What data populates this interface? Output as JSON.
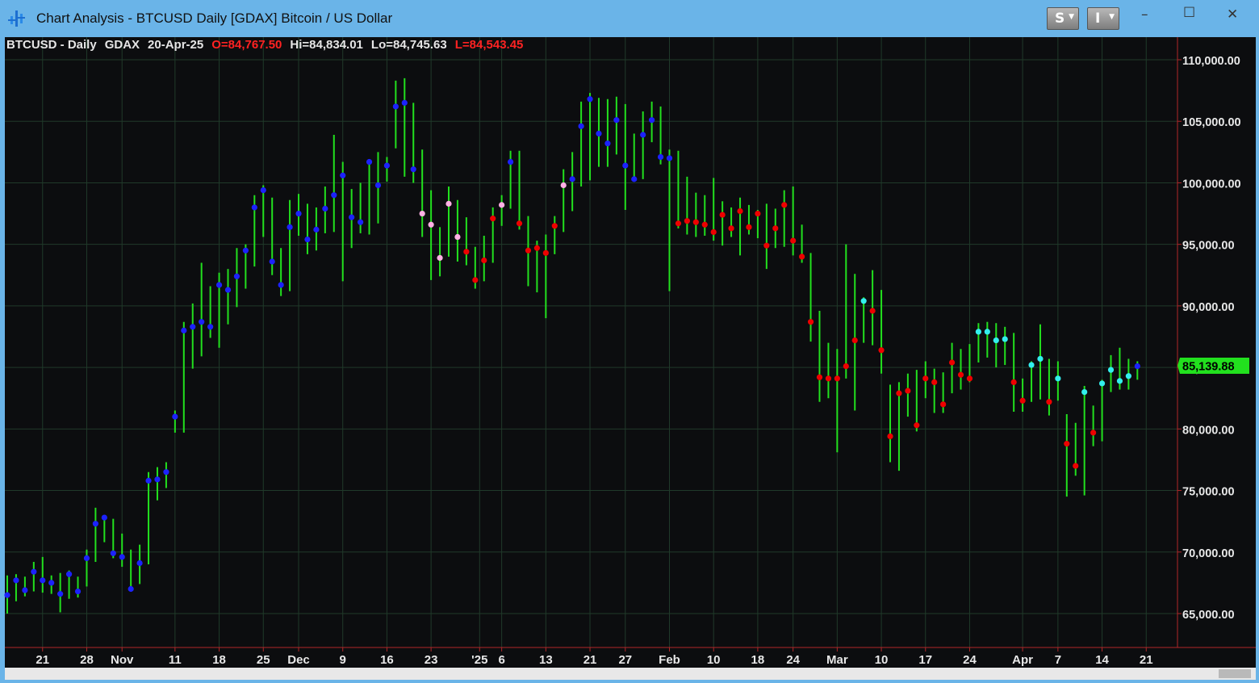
{
  "window": {
    "title": "Chart Analysis - BTCUSD Daily [GDAX] Bitcoin / US Dollar",
    "btn_s": "S",
    "btn_i": "I",
    "minimize_icon": "minimize-icon",
    "maximize_icon": "maximize-icon",
    "close_icon": "close-icon"
  },
  "header": {
    "symbol": "BTCUSD - Daily",
    "exchange": "GDAX",
    "date": "20-Apr-25",
    "open": "O=84,767.50",
    "high": "Hi=84,834.01",
    "low": "Lo=84,745.63",
    "last": "L=84,543.45"
  },
  "colors": {
    "bar": "#22e01e",
    "grid": "#203a2a",
    "axis_line": "#b0282a",
    "background": "#0c0d0f",
    "dot_blue": "#1c22ff",
    "dot_red": "#ee0000",
    "dot_pink": "#ffb0e4",
    "dot_cyan": "#33eeee",
    "last_price_bg": "#22e01e"
  },
  "chart_data": {
    "type": "ohlc-range-bars",
    "ylim": [
      62000,
      111000
    ],
    "y_ticks": [
      {
        "value": 65000,
        "label": "65,000.00"
      },
      {
        "value": 70000,
        "label": "70,000.00"
      },
      {
        "value": 75000,
        "label": "75,000.00"
      },
      {
        "value": 80000,
        "label": "80,000.00"
      },
      {
        "value": 85000,
        "label": "85,000.00"
      },
      {
        "value": 90000,
        "label": "90,000.00"
      },
      {
        "value": 95000,
        "label": "95,000.00"
      },
      {
        "value": 100000,
        "label": "100,000.00"
      },
      {
        "value": 105000,
        "label": "105,000.00"
      },
      {
        "value": 110000,
        "label": "110,000.00"
      }
    ],
    "x_ticks": [
      {
        "day": 4,
        "label": "21"
      },
      {
        "day": 9,
        "label": "28"
      },
      {
        "day": 13,
        "label": "Nov"
      },
      {
        "day": 19,
        "label": "11"
      },
      {
        "day": 24,
        "label": "18"
      },
      {
        "day": 29,
        "label": "25"
      },
      {
        "day": 33,
        "label": "Dec"
      },
      {
        "day": 38,
        "label": "9"
      },
      {
        "day": 43,
        "label": "16"
      },
      {
        "day": 48,
        "label": "23"
      },
      {
        "day": 53.5,
        "label": "'25"
      },
      {
        "day": 56,
        "label": "6"
      },
      {
        "day": 61,
        "label": "13"
      },
      {
        "day": 66,
        "label": "21"
      },
      {
        "day": 70,
        "label": "27"
      },
      {
        "day": 75,
        "label": "Feb"
      },
      {
        "day": 80,
        "label": "10"
      },
      {
        "day": 85,
        "label": "18"
      },
      {
        "day": 89,
        "label": "24"
      },
      {
        "day": 94,
        "label": "Mar"
      },
      {
        "day": 99,
        "label": "10"
      },
      {
        "day": 104,
        "label": "17"
      },
      {
        "day": 109,
        "label": "24"
      },
      {
        "day": 115,
        "label": "Apr"
      },
      {
        "day": 119,
        "label": "7"
      },
      {
        "day": 124,
        "label": "14"
      },
      {
        "day": 129,
        "label": "21"
      }
    ],
    "last_price": 85139.88,
    "last_price_label": "85,139.88",
    "bars": [
      {
        "h": 68100,
        "l": 65000,
        "c": 66500,
        "m": "blue"
      },
      {
        "h": 68200,
        "l": 66000,
        "c": 67700,
        "m": "blue"
      },
      {
        "h": 68000,
        "l": 66400,
        "c": 66900,
        "m": "blue"
      },
      {
        "h": 69200,
        "l": 66800,
        "c": 68400,
        "m": "blue"
      },
      {
        "h": 69600,
        "l": 66700,
        "c": 67700,
        "m": "blue"
      },
      {
        "h": 68100,
        "l": 66600,
        "c": 67500,
        "m": "blue"
      },
      {
        "h": 68300,
        "l": 65100,
        "c": 66600,
        "m": "blue"
      },
      {
        "h": 68500,
        "l": 66200,
        "c": 68200,
        "m": "blue"
      },
      {
        "h": 68000,
        "l": 66300,
        "c": 66800,
        "m": "blue"
      },
      {
        "h": 70200,
        "l": 67200,
        "c": 69500,
        "m": "blue"
      },
      {
        "h": 73600,
        "l": 69200,
        "c": 72300,
        "m": "blue"
      },
      {
        "h": 73000,
        "l": 70800,
        "c": 72800,
        "m": "blue"
      },
      {
        "h": 72700,
        "l": 69500,
        "c": 69900,
        "m": "blue"
      },
      {
        "h": 71500,
        "l": 68800,
        "c": 69600,
        "m": "blue"
      },
      {
        "h": 70200,
        "l": 66800,
        "c": 67000,
        "m": "blue"
      },
      {
        "h": 70600,
        "l": 67400,
        "c": 69100,
        "m": "blue"
      },
      {
        "h": 76500,
        "l": 69000,
        "c": 75800,
        "m": "blue"
      },
      {
        "h": 76900,
        "l": 74200,
        "c": 75900,
        "m": "blue"
      },
      {
        "h": 77300,
        "l": 75200,
        "c": 76500,
        "m": "blue"
      },
      {
        "h": 81500,
        "l": 79700,
        "c": 81000,
        "m": "blue"
      },
      {
        "h": 88700,
        "l": 79700,
        "c": 88000,
        "m": "blue"
      },
      {
        "h": 90200,
        "l": 84900,
        "c": 88300,
        "m": "blue"
      },
      {
        "h": 93500,
        "l": 85900,
        "c": 88700,
        "m": "blue"
      },
      {
        "h": 91600,
        "l": 87400,
        "c": 88300,
        "m": "blue"
      },
      {
        "h": 92700,
        "l": 86600,
        "c": 91700,
        "m": "blue"
      },
      {
        "h": 93000,
        "l": 88500,
        "c": 91300,
        "m": "blue"
      },
      {
        "h": 94700,
        "l": 89900,
        "c": 92400,
        "m": "blue"
      },
      {
        "h": 95000,
        "l": 91400,
        "c": 94500,
        "m": "blue"
      },
      {
        "h": 99000,
        "l": 93200,
        "c": 98000,
        "m": "blue"
      },
      {
        "h": 99800,
        "l": 95600,
        "c": 99400,
        "m": "blue"
      },
      {
        "h": 98800,
        "l": 92500,
        "c": 93600,
        "m": "blue"
      },
      {
        "h": 94700,
        "l": 90800,
        "c": 91700,
        "m": "blue"
      },
      {
        "h": 98600,
        "l": 91200,
        "c": 96400,
        "m": "blue"
      },
      {
        "h": 99100,
        "l": 95700,
        "c": 97500,
        "m": "blue"
      },
      {
        "h": 98300,
        "l": 94200,
        "c": 95400,
        "m": "blue"
      },
      {
        "h": 98000,
        "l": 94500,
        "c": 96200,
        "m": "blue"
      },
      {
        "h": 99700,
        "l": 95900,
        "c": 97900,
        "m": "blue"
      },
      {
        "h": 103900,
        "l": 96000,
        "c": 99000,
        "m": "blue"
      },
      {
        "h": 101700,
        "l": 92000,
        "c": 100600,
        "m": "blue"
      },
      {
        "h": 99500,
        "l": 94700,
        "c": 97200,
        "m": "blue"
      },
      {
        "h": 100000,
        "l": 95900,
        "c": 96800,
        "m": "blue"
      },
      {
        "h": 101900,
        "l": 95800,
        "c": 101700,
        "m": "blue"
      },
      {
        "h": 102500,
        "l": 96700,
        "c": 99800,
        "m": "blue"
      },
      {
        "h": 102100,
        "l": 100100,
        "c": 101400,
        "m": "blue"
      },
      {
        "h": 108300,
        "l": 102800,
        "c": 106200,
        "m": "blue"
      },
      {
        "h": 108500,
        "l": 100500,
        "c": 106500,
        "m": "blue"
      },
      {
        "h": 106500,
        "l": 100000,
        "c": 101100,
        "m": "blue"
      },
      {
        "h": 102700,
        "l": 95600,
        "c": 97500,
        "m": "pink"
      },
      {
        "h": 99400,
        "l": 92100,
        "c": 96600,
        "m": "pink"
      },
      {
        "h": 96400,
        "l": 92400,
        "c": 93900,
        "m": "pink"
      },
      {
        "h": 99700,
        "l": 94000,
        "c": 98300,
        "m": "pink"
      },
      {
        "h": 98600,
        "l": 93600,
        "c": 95600,
        "m": "pink"
      },
      {
        "h": 97200,
        "l": 93300,
        "c": 94400,
        "m": "red"
      },
      {
        "h": 94800,
        "l": 91400,
        "c": 92100,
        "m": "red"
      },
      {
        "h": 95700,
        "l": 92000,
        "c": 93700,
        "m": "red"
      },
      {
        "h": 98000,
        "l": 93500,
        "c": 97100,
        "m": "red"
      },
      {
        "h": 99000,
        "l": 96500,
        "c": 98200,
        "m": "pink"
      },
      {
        "h": 102600,
        "l": 97900,
        "c": 101700,
        "m": "blue"
      },
      {
        "h": 102600,
        "l": 96200,
        "c": 96700,
        "m": "red"
      },
      {
        "h": 97300,
        "l": 91600,
        "c": 94500,
        "m": "red"
      },
      {
        "h": 95300,
        "l": 91100,
        "c": 94700,
        "m": "red"
      },
      {
        "h": 95800,
        "l": 89000,
        "c": 94300,
        "m": "red"
      },
      {
        "h": 97300,
        "l": 94200,
        "c": 96500,
        "m": "red"
      },
      {
        "h": 101100,
        "l": 96000,
        "c": 99800,
        "m": "pink"
      },
      {
        "h": 102500,
        "l": 97700,
        "c": 100300,
        "m": "blue"
      },
      {
        "h": 106600,
        "l": 99700,
        "c": 104600,
        "m": "blue"
      },
      {
        "h": 107300,
        "l": 100200,
        "c": 106800,
        "m": "blue"
      },
      {
        "h": 106900,
        "l": 101300,
        "c": 104000,
        "m": "blue"
      },
      {
        "h": 106800,
        "l": 101300,
        "c": 103200,
        "m": "blue"
      },
      {
        "h": 107000,
        "l": 102300,
        "c": 105100,
        "m": "blue"
      },
      {
        "h": 106400,
        "l": 97800,
        "c": 101400,
        "m": "blue"
      },
      {
        "h": 104000,
        "l": 100400,
        "c": 100300,
        "m": "blue"
      },
      {
        "h": 105800,
        "l": 100300,
        "c": 103900,
        "m": "blue"
      },
      {
        "h": 106600,
        "l": 103300,
        "c": 105100,
        "m": "blue"
      },
      {
        "h": 106200,
        "l": 101500,
        "c": 102100,
        "m": "blue"
      },
      {
        "h": 102700,
        "l": 91200,
        "c": 102000,
        "m": "blue"
      },
      {
        "h": 102600,
        "l": 96300,
        "c": 96700,
        "m": "red"
      },
      {
        "h": 100500,
        "l": 95800,
        "c": 96900,
        "m": "red"
      },
      {
        "h": 99200,
        "l": 95600,
        "c": 96800,
        "m": "red"
      },
      {
        "h": 99000,
        "l": 95700,
        "c": 96600,
        "m": "red"
      },
      {
        "h": 100400,
        "l": 95300,
        "c": 96000,
        "m": "red"
      },
      {
        "h": 98500,
        "l": 94900,
        "c": 97400,
        "m": "red"
      },
      {
        "h": 98000,
        "l": 95600,
        "c": 96300,
        "m": "red"
      },
      {
        "h": 98800,
        "l": 94100,
        "c": 97700,
        "m": "red"
      },
      {
        "h": 98200,
        "l": 95800,
        "c": 96400,
        "m": "red"
      },
      {
        "h": 97800,
        "l": 95500,
        "c": 97500,
        "m": "red"
      },
      {
        "h": 98300,
        "l": 93000,
        "c": 94900,
        "m": "red"
      },
      {
        "h": 97900,
        "l": 94700,
        "c": 96300,
        "m": "red"
      },
      {
        "h": 99400,
        "l": 94800,
        "c": 98200,
        "m": "red"
      },
      {
        "h": 99700,
        "l": 94100,
        "c": 95300,
        "m": "red"
      },
      {
        "h": 96600,
        "l": 93500,
        "c": 94000,
        "m": "red"
      },
      {
        "h": 94300,
        "l": 87100,
        "c": 88700,
        "m": "red"
      },
      {
        "h": 89600,
        "l": 82200,
        "c": 84200,
        "m": "red"
      },
      {
        "h": 87000,
        "l": 82500,
        "c": 84100,
        "m": "red"
      },
      {
        "h": 86500,
        "l": 78100,
        "c": 84100,
        "m": "red"
      },
      {
        "h": 95000,
        "l": 84100,
        "c": 85100,
        "m": "red"
      },
      {
        "h": 92600,
        "l": 81500,
        "c": 87200,
        "m": "red"
      },
      {
        "h": 90700,
        "l": 87000,
        "c": 90400,
        "m": "cyan"
      },
      {
        "h": 92900,
        "l": 86800,
        "c": 89600,
        "m": "red"
      },
      {
        "h": 91300,
        "l": 84500,
        "c": 86400,
        "m": "red"
      },
      {
        "h": 83600,
        "l": 77300,
        "c": 79400,
        "m": "red"
      },
      {
        "h": 83800,
        "l": 76600,
        "c": 82900,
        "m": "red"
      },
      {
        "h": 84500,
        "l": 81000,
        "c": 83100,
        "m": "red"
      },
      {
        "h": 84800,
        "l": 79800,
        "c": 80300,
        "m": "red"
      },
      {
        "h": 85500,
        "l": 82500,
        "c": 84100,
        "m": "red"
      },
      {
        "h": 84900,
        "l": 81300,
        "c": 83800,
        "m": "red"
      },
      {
        "h": 84600,
        "l": 81300,
        "c": 82000,
        "m": "red"
      },
      {
        "h": 87000,
        "l": 82900,
        "c": 85400,
        "m": "red"
      },
      {
        "h": 86500,
        "l": 83200,
        "c": 84400,
        "m": "red"
      },
      {
        "h": 86900,
        "l": 83800,
        "c": 84100,
        "m": "red"
      },
      {
        "h": 88600,
        "l": 85400,
        "c": 87900,
        "m": "cyan"
      },
      {
        "h": 88700,
        "l": 85800,
        "c": 87900,
        "m": "cyan"
      },
      {
        "h": 88600,
        "l": 85000,
        "c": 87200,
        "m": "cyan"
      },
      {
        "h": 88300,
        "l": 85200,
        "c": 87300,
        "m": "cyan"
      },
      {
        "h": 87800,
        "l": 81400,
        "c": 83800,
        "m": "red"
      },
      {
        "h": 84100,
        "l": 81400,
        "c": 82300,
        "m": "red"
      },
      {
        "h": 85500,
        "l": 82200,
        "c": 85200,
        "m": "cyan"
      },
      {
        "h": 88500,
        "l": 82400,
        "c": 85700,
        "m": "cyan"
      },
      {
        "h": 85700,
        "l": 81100,
        "c": 82200,
        "m": "red"
      },
      {
        "h": 85500,
        "l": 82300,
        "c": 84100,
        "m": "cyan"
      },
      {
        "h": 81200,
        "l": 74500,
        "c": 78800,
        "m": "red"
      },
      {
        "h": 80500,
        "l": 76200,
        "c": 77000,
        "m": "red"
      },
      {
        "h": 83500,
        "l": 74600,
        "c": 83000,
        "m": "cyan"
      },
      {
        "h": 81900,
        "l": 78600,
        "c": 79700,
        "m": "red"
      },
      {
        "h": 84000,
        "l": 79000,
        "c": 83700,
        "m": "cyan"
      },
      {
        "h": 86000,
        "l": 83000,
        "c": 84800,
        "m": "cyan"
      },
      {
        "h": 86600,
        "l": 83200,
        "c": 83900,
        "m": "cyan"
      },
      {
        "h": 85700,
        "l": 83200,
        "c": 84300,
        "m": "cyan"
      },
      {
        "h": 85500,
        "l": 84000,
        "c": 85100,
        "m": "blue"
      }
    ]
  }
}
